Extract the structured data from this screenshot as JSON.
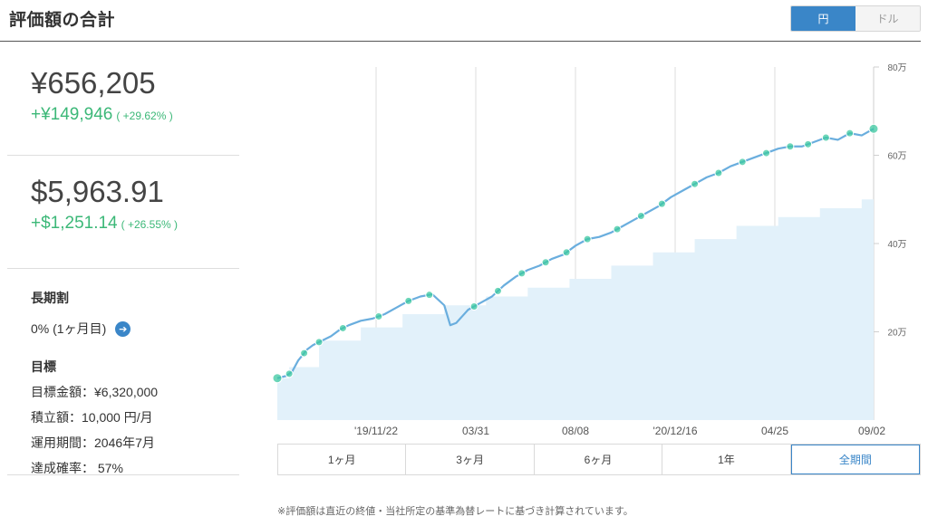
{
  "header": {
    "title": "評価額の合計"
  },
  "currency_toggle": {
    "yen": "円",
    "dollar": "ドル",
    "selected": "円"
  },
  "yen_summary": {
    "value": "¥656,205",
    "gain": "+¥149,946",
    "gain_pct": "( +29.62% )"
  },
  "usd_summary": {
    "value": "$5,963.91",
    "gain": "+$1,251.14",
    "gain_pct": "( +26.55% )"
  },
  "long_term": {
    "label": "長期割",
    "value": "0% (1ヶ月目)"
  },
  "goal": {
    "title": "目標",
    "amount": "目標金額：¥6,320,000",
    "monthly": "積立額：10,000 円/月",
    "period": "運用期間：2046年7月",
    "probability": "達成確率： 57%"
  },
  "range_tabs": [
    "1ヶ月",
    "3ヶ月",
    "6ヶ月",
    "1年",
    "全期間"
  ],
  "active_range": "全期間",
  "footnote": "※評価額は直近の終値・当社所定の基準為替レートに基づき計算されています。",
  "colors": {
    "accent": "#3a86c8",
    "gain": "#3cb878",
    "line": "#6aaede",
    "area": "#e2f1fa",
    "marker": "#3cc8a0"
  },
  "chart_data": {
    "type": "line",
    "x_tick_labels": [
      "'19/11/22",
      "03/31",
      "08/08",
      "'20/12/16",
      "04/25",
      "09/02"
    ],
    "y_tick_labels": [
      "20万",
      "40万",
      "60万",
      "80万"
    ],
    "ylim": [
      0,
      80
    ],
    "y_unit": "万",
    "xlim": [
      0,
      100
    ],
    "grid": true,
    "series": [
      {
        "kind": "line",
        "x": [
          0,
          1.5,
          2.5,
          3.5,
          5,
          6,
          7.5,
          9,
          10.5,
          12,
          14,
          16,
          18,
          20,
          22,
          24,
          26,
          28,
          29,
          30,
          31,
          32,
          34,
          36,
          38,
          40,
          42,
          44,
          46,
          48,
          50,
          52,
          54,
          56,
          58,
          60,
          62,
          64,
          66,
          68,
          70,
          72,
          74,
          76,
          78,
          80,
          82,
          84,
          86,
          88,
          90,
          92,
          94,
          96,
          98,
          100
        ],
        "y": [
          9.5,
          10,
          11,
          13.5,
          16,
          17,
          18,
          19,
          20.5,
          21.5,
          22.5,
          23,
          24,
          25.5,
          27,
          28,
          28.5,
          26,
          21.5,
          22,
          23.5,
          25,
          26.5,
          28,
          30.5,
          32.5,
          34,
          35,
          36.5,
          37.5,
          39.5,
          41,
          41.5,
          42.5,
          44,
          45.5,
          47,
          48.5,
          50.5,
          52,
          53.5,
          55,
          56,
          57.5,
          58.5,
          59.5,
          60.5,
          61.5,
          62,
          62,
          63,
          64,
          63.5,
          65,
          64.5,
          66
        ]
      },
      {
        "kind": "area",
        "x": [
          0,
          2,
          2,
          7,
          7,
          14,
          14,
          21,
          21,
          28,
          28,
          35,
          35,
          42,
          42,
          49,
          49,
          56,
          56,
          63,
          63,
          70,
          70,
          77,
          77,
          84,
          84,
          91,
          91,
          98,
          98,
          100
        ],
        "y": [
          9.5,
          9.5,
          12,
          12,
          18,
          18,
          21,
          21,
          24,
          24,
          26,
          26,
          28,
          28,
          30,
          30,
          32,
          32,
          35,
          35,
          38,
          38,
          41,
          41,
          44,
          44,
          46,
          46,
          48,
          48,
          50,
          50
        ]
      }
    ],
    "markers_x": [
      0,
      2,
      4.5,
      7,
      11,
      17,
      22,
      25.5,
      33,
      37,
      41,
      45,
      48.5,
      52,
      57,
      61,
      64.5,
      70,
      74,
      78,
      82,
      86,
      89,
      92,
      96,
      100
    ]
  }
}
